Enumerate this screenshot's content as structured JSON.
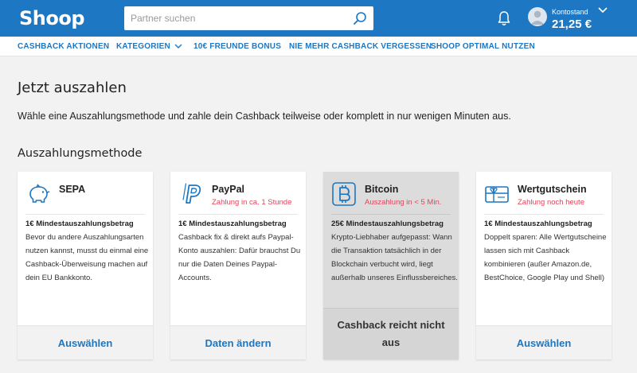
{
  "header": {
    "logo": "Shoop",
    "search_placeholder": "Partner suchen",
    "account_label": "Kontostand",
    "account_value": "21,25 €"
  },
  "nav": {
    "items": [
      "CASHBACK AKTIONEN",
      "KATEGORIEN",
      "10€ FREUNDE BONUS",
      "NIE MEHR CASHBACK VERGESSEN",
      "SHOOP OPTIMAL NUTZEN"
    ]
  },
  "page": {
    "title": "Jetzt auszahlen",
    "description": "Wähle eine Auszahlungsmethode und zahle dein Cashback teilweise oder komplett in nur wenigen Minuten aus.",
    "section_title": "Auszahlungsmethode"
  },
  "colors": {
    "brand": "#1d77c2",
    "alert": "#e3445a"
  },
  "methods": [
    {
      "name": "SEPA",
      "subtitle": "",
      "minimum": "1€ Mindestauszahlungsbetrag",
      "description": "Bevor du andere Auszahlungsarten nutzen kannst, musst du einmal eine Cashback-Überweisung machen auf dein EU Bankkonto.",
      "action": "Auswählen",
      "icon": "piggy-bank-icon"
    },
    {
      "name": "PayPal",
      "subtitle": "Zahlung in ca. 1 Stunde",
      "minimum": "1€ Mindestauszahlungsbetrag",
      "description": "Cashback fix & direkt aufs Paypal-Konto auszahlen: Dafür brauchst Du nur die Daten Deines Paypal-Accounts.",
      "action": "Daten ändern",
      "icon": "paypal-icon"
    },
    {
      "name": "Bitcoin",
      "subtitle": "Auszahlung in < 5 Min.",
      "minimum": "25€ Mindestauszahlungsbetrag",
      "description": "Krypto-Liebhaber aufgepasst: Wann die Transaktion tatsächlich in der Blockchain verbucht wird, liegt außerhalb unseres Einflussbereiches.",
      "action": "Cashback reicht nicht aus",
      "icon": "bitcoin-icon"
    },
    {
      "name": "Wertgutschein",
      "subtitle": "Zahlung noch heute",
      "minimum": "1€ Mindestauszahlungsbetrag",
      "description": "Doppelt sparen: Alle Wertgutscheine lassen sich mit Cashback kombinieren (außer Amazon.de, BestChoice, Google Play und Shell)",
      "action": "Auswählen",
      "icon": "gift-card-icon"
    }
  ]
}
